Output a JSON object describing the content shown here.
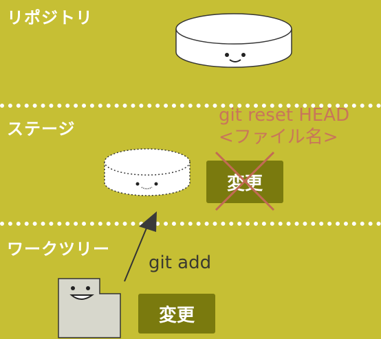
{
  "zones": {
    "repository": "リポジトリ",
    "stage": "ステージ",
    "worktree": "ワークツリー"
  },
  "stage_change_label": "変更",
  "worktree_change_label": "変更",
  "commands": {
    "add": "git add",
    "reset_line1": "git reset HEAD",
    "reset_line2": "<ファイル名>"
  },
  "colors": {
    "background": "#c6bf34",
    "change_box": "#7a7a0e",
    "reset_text": "#c8765a",
    "cross": "#c26a55",
    "add_text": "#3a3a30"
  }
}
